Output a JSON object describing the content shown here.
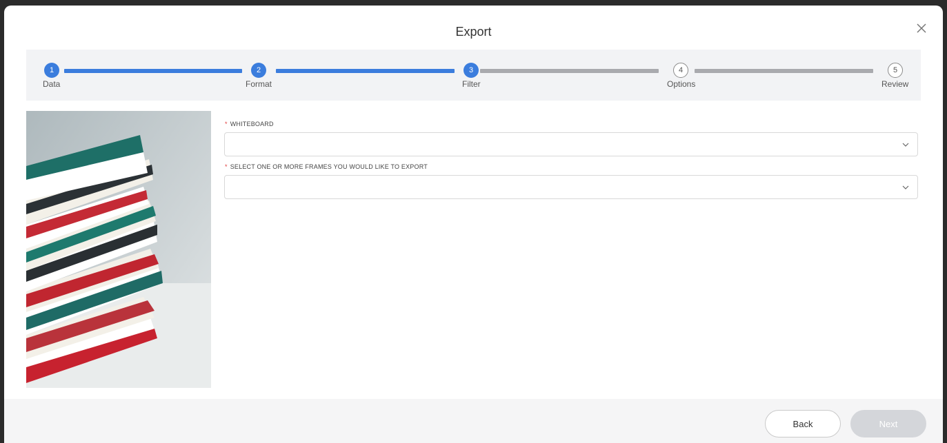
{
  "dialog": {
    "title": "Export"
  },
  "steps": [
    {
      "number": "1",
      "label": "Data",
      "state": "complete"
    },
    {
      "number": "2",
      "label": "Format",
      "state": "complete"
    },
    {
      "number": "3",
      "label": "Filter",
      "state": "current"
    },
    {
      "number": "4",
      "label": "Options",
      "state": "upcoming"
    },
    {
      "number": "5",
      "label": "Review",
      "state": "upcoming"
    }
  ],
  "form": {
    "whiteboard": {
      "required_mark": "*",
      "label": "WHITEBOARD",
      "value": ""
    },
    "frames": {
      "required_mark": "*",
      "label": "SELECT ONE OR MORE FRAMES YOU WOULD LIKE TO EXPORT",
      "value": ""
    }
  },
  "footer": {
    "back_label": "Back",
    "next_label": "Next"
  },
  "colors": {
    "accent": "#3b7ddd",
    "inactive": "#a9aaae",
    "required": "#e03c3c",
    "next_disabled": "#d4d6da"
  },
  "icons": {
    "close": "close-icon",
    "dropdown": "chevron-down-icon"
  }
}
